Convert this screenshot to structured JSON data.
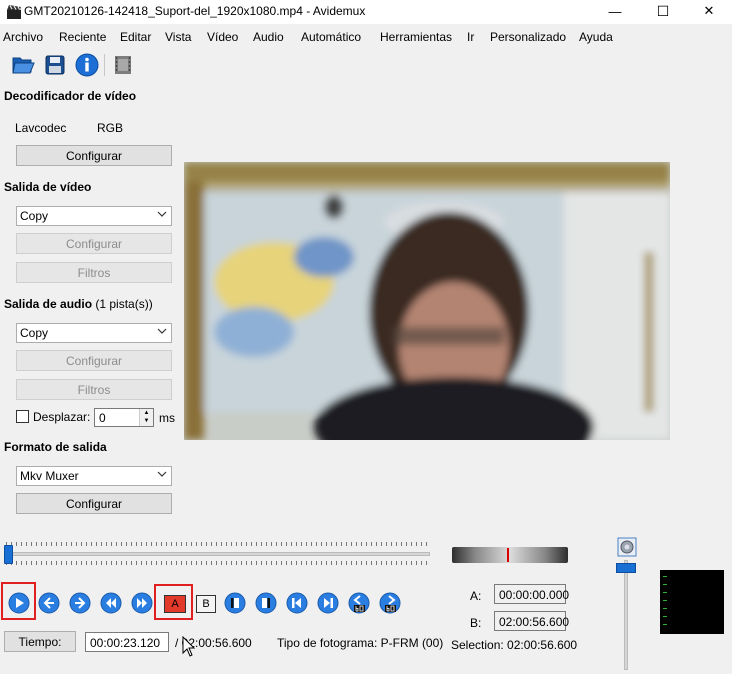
{
  "window": {
    "title": "GMT20210126-142418_Suport-del_1920x1080.mp4 - Avidemux",
    "minimize": "—",
    "maximize": "☐",
    "close": "✕"
  },
  "menu": [
    "Archivo",
    "Reciente",
    "Editar",
    "Vista",
    "Vídeo",
    "Audio",
    "Automático",
    "Herramientas",
    "Ir",
    "Personalizado",
    "Ayuda"
  ],
  "video_decoder": {
    "title": "Decodificador de vídeo",
    "codec": "Lavcodec",
    "colorspace": "RGB",
    "configure_label": "Configurar"
  },
  "video_output": {
    "title": "Salida de vídeo",
    "selected": "Copy",
    "configure_label": "Configurar",
    "filters_label": "Filtros"
  },
  "audio_output": {
    "title": "Salida de audio",
    "tracks": "(1 pista(s))",
    "selected": "Copy",
    "configure_label": "Configurar",
    "filters_label": "Filtros",
    "shift_label": "Desplazar:",
    "shift_value": "0",
    "shift_unit": "ms"
  },
  "output_format": {
    "title": "Formato de salida",
    "selected": "Mkv Muxer",
    "configure_label": "Configurar"
  },
  "markers": {
    "a_button": "A",
    "b_button": "B",
    "a_label": "A:",
    "a_value": "00:00:00.000",
    "b_label": "B:",
    "b_value": "02:00:56.600",
    "selection": "Selection: 02:00:56.600"
  },
  "status": {
    "time_button": "Tiempo:",
    "current_time": "00:00:23.120",
    "total_time": "/ 02:00:56.600",
    "frame_type": "Tipo de fotograma:  P-FRM (00)"
  },
  "timeline": {
    "position_fraction": 0.003
  },
  "colors": {
    "accent": "#1a6fd4",
    "highlight_border": "#e02020",
    "jog_marker": "#dd0000"
  },
  "icons": {
    "toolbar": [
      "open-folder-icon",
      "save-icon",
      "info-icon",
      "filmstrip-icon"
    ],
    "controls": [
      "play-icon",
      "previous-frame-icon",
      "next-frame-icon",
      "rewind-icon",
      "fast-forward-icon",
      "set-marker-a-icon",
      "set-marker-b-icon",
      "previous-keyframe-icon",
      "next-keyframe-icon",
      "go-to-marker-a-icon",
      "go-to-marker-b-icon",
      "back-60-icon",
      "forward-60-icon"
    ]
  }
}
